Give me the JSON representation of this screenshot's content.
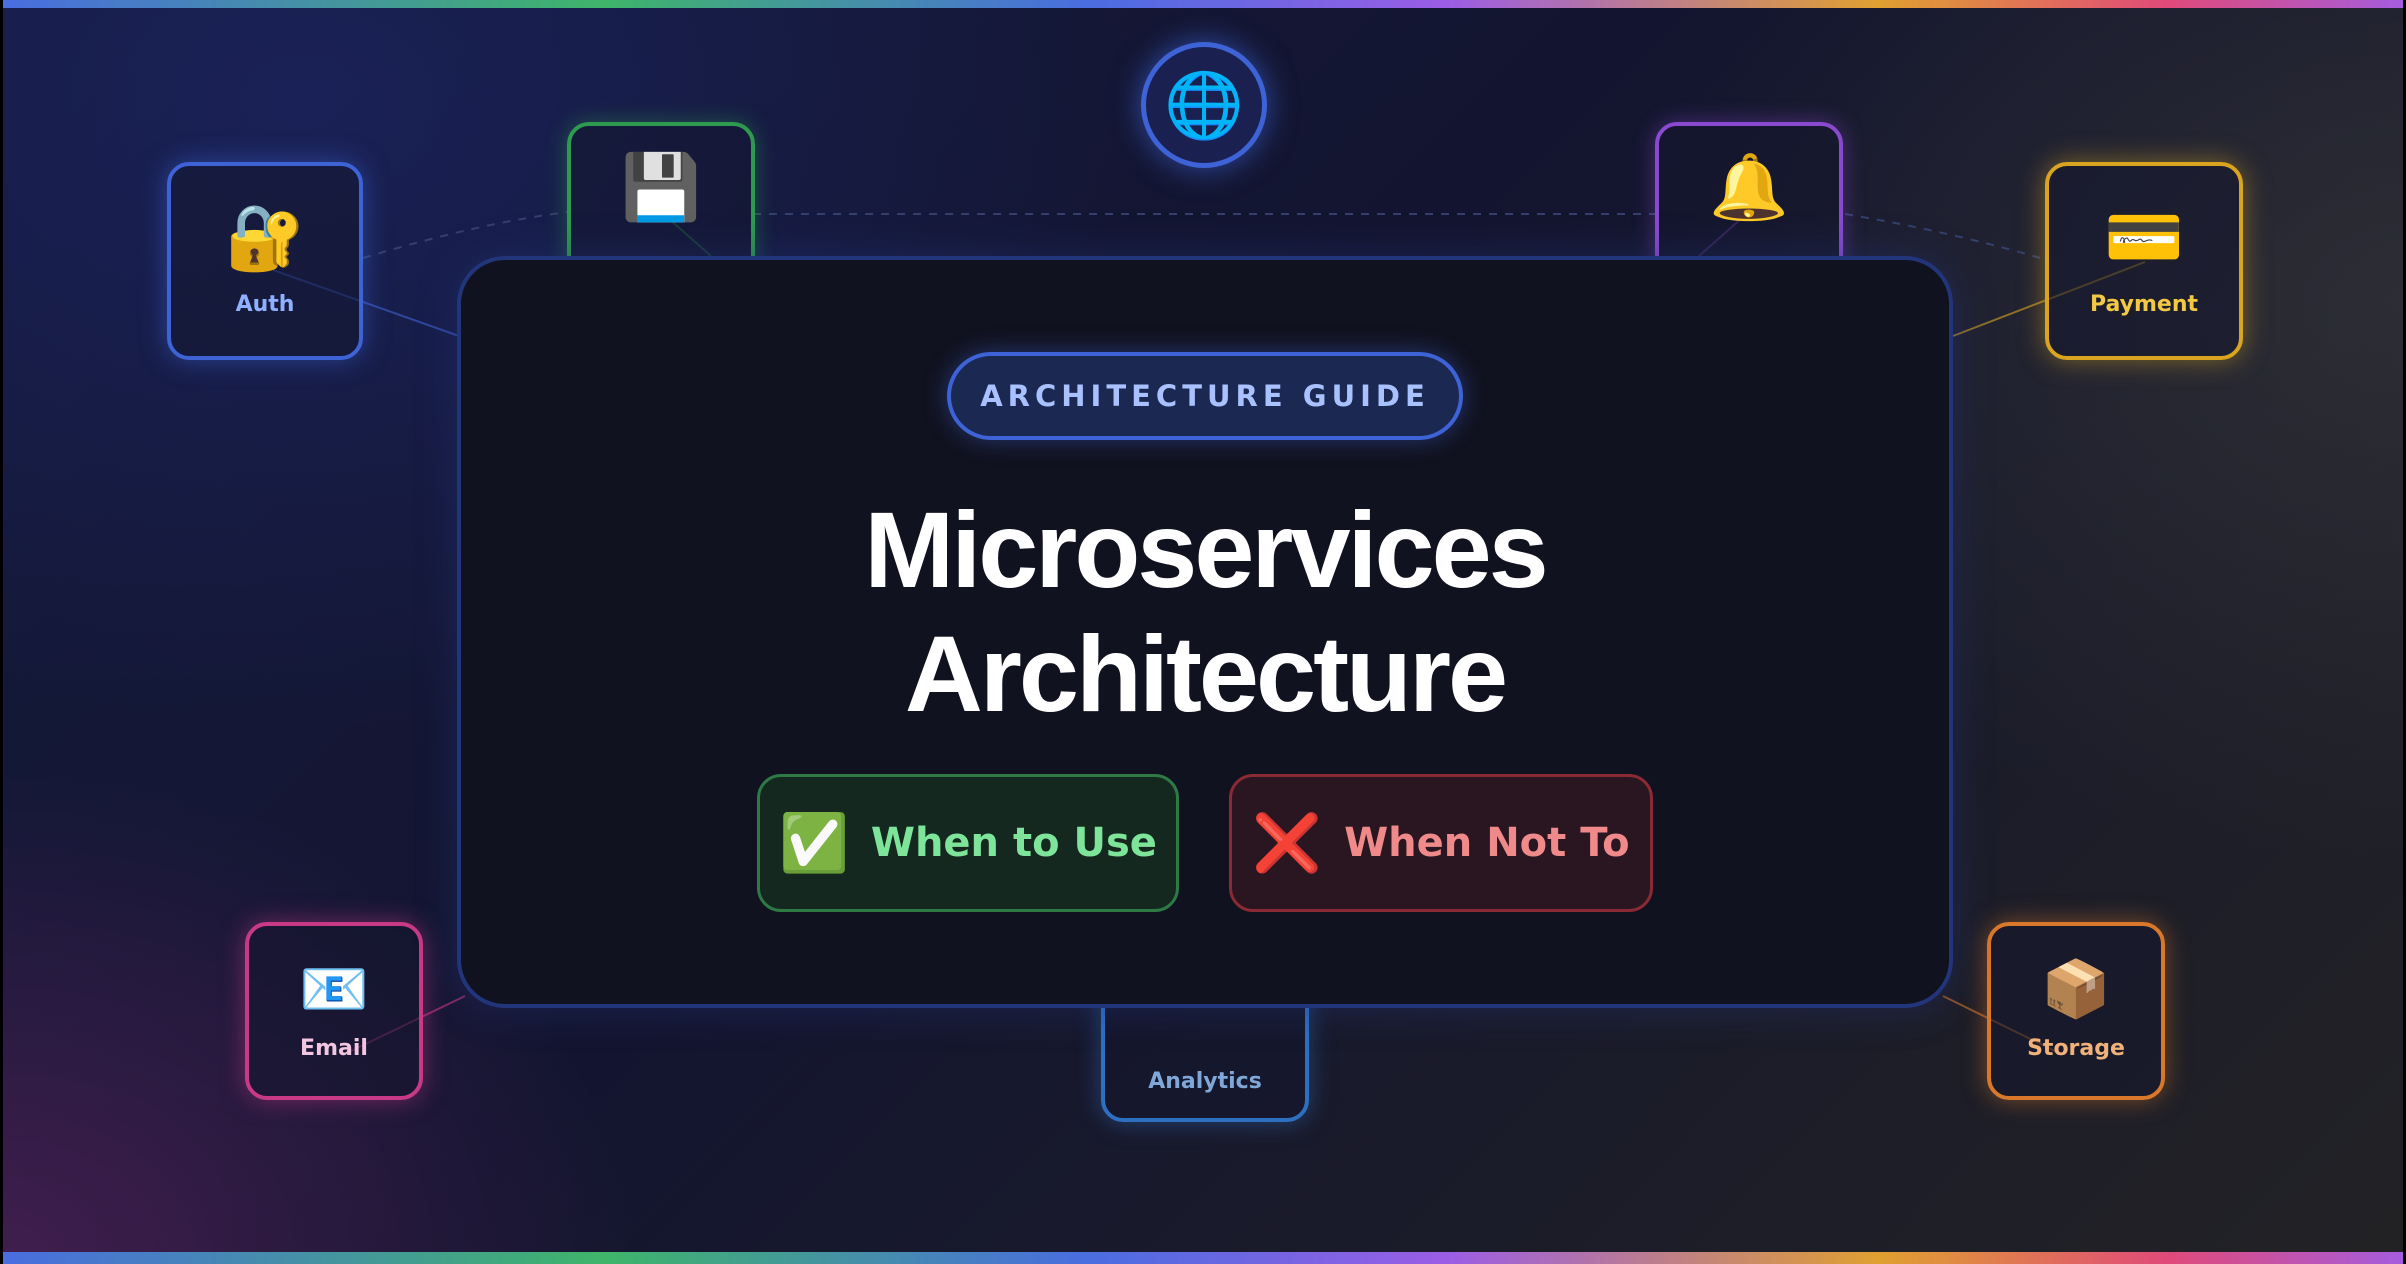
{
  "badge": "ARCHITECTURE GUIDE",
  "title": {
    "line1": "Microservices",
    "line2": "Architecture"
  },
  "cta": {
    "use": {
      "icon": "✅",
      "label": "When to Use",
      "color": "#7ee49a"
    },
    "not": {
      "icon": "❌",
      "label": "When Not To",
      "color": "#f08a8a"
    }
  },
  "hub": {
    "icon": "🌐",
    "icon_name": "globe-icon"
  },
  "nodes": {
    "auth": {
      "icon": "🔐",
      "icon_name": "lock-key-icon",
      "label": "Auth",
      "color": "#3d63d6"
    },
    "database": {
      "icon": "💾",
      "icon_name": "floppy-disk-icon",
      "color": "#2e9a4f"
    },
    "notifications": {
      "icon": "🔔",
      "icon_name": "bell-icon",
      "color": "#8a4ad0"
    },
    "payment": {
      "icon": "💳",
      "icon_name": "credit-card-icon",
      "label": "Payment",
      "color": "#d9a520"
    },
    "email": {
      "icon": "📧",
      "icon_name": "email-icon",
      "label": "Email",
      "color": "#c83a86"
    },
    "analytics": {
      "icon": "📊",
      "icon_name": "bar-chart-icon",
      "label": "Analytics",
      "color": "#2f6fc0"
    },
    "storage": {
      "icon": "📦",
      "icon_name": "package-icon",
      "label": "Storage",
      "color": "#d9772a"
    }
  }
}
